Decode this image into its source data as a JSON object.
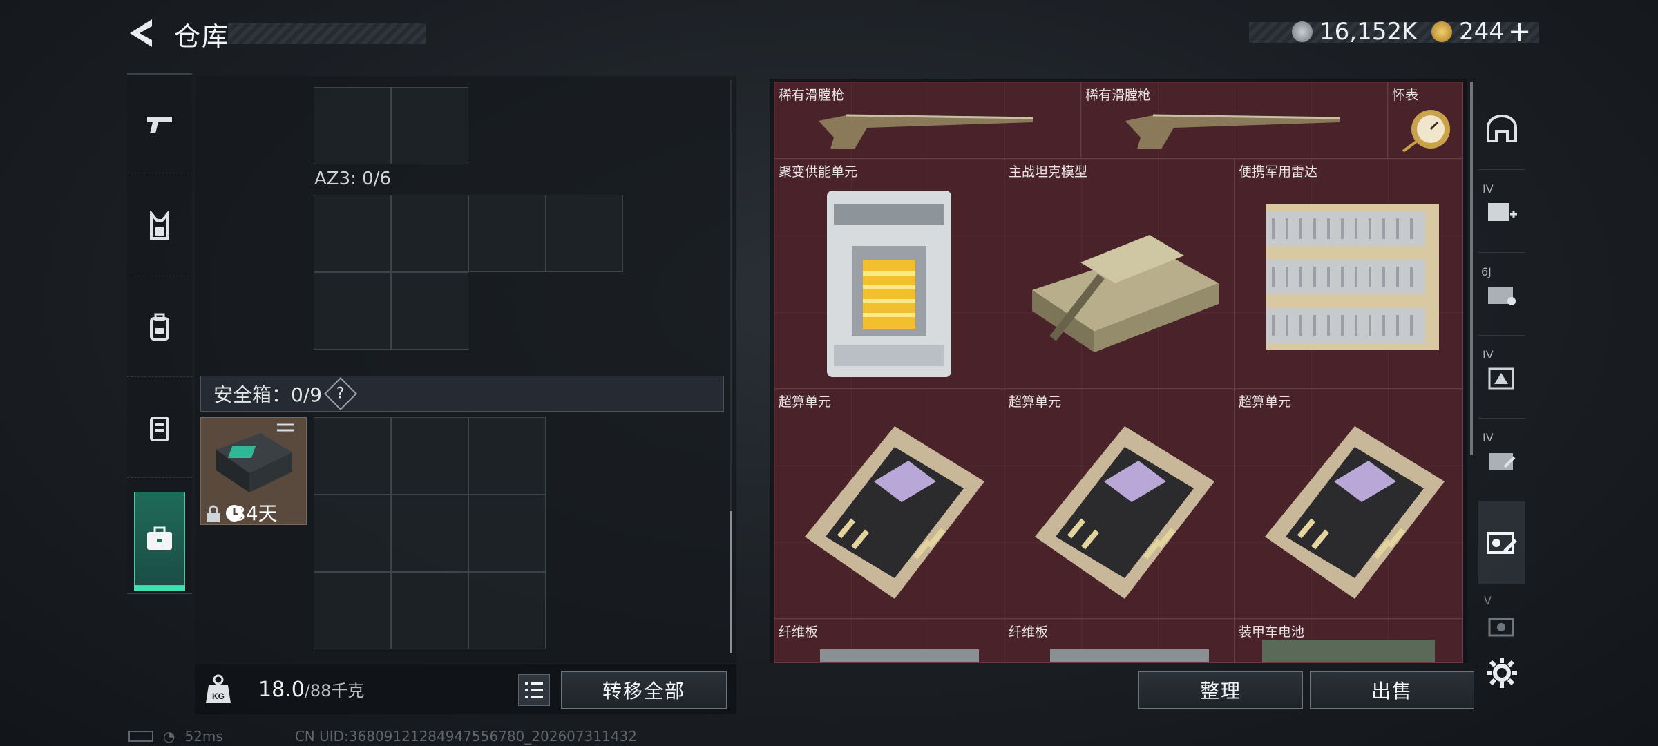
{
  "header": {
    "title": "仓库",
    "currency_silver": "16,152K",
    "currency_gold": "244",
    "gold_plus": "+"
  },
  "left_tabs": [
    {
      "name": "weapon",
      "icon": "pistol-icon"
    },
    {
      "name": "vest",
      "icon": "vest-icon"
    },
    {
      "name": "backpack",
      "icon": "backpack-icon"
    },
    {
      "name": "container",
      "icon": "rig-icon"
    },
    {
      "name": "safebox",
      "icon": "briefcase-icon",
      "active": true
    }
  ],
  "loadout": {
    "az3_label": "AZ3: 0/6",
    "safe_box_label": "安全箱：0/9",
    "help": "?",
    "safe_box_days": "34天"
  },
  "weight": {
    "current": "18.0",
    "max": "/88千克",
    "kg_icon_text": "KG"
  },
  "buttons": {
    "transfer_all": "转移全部",
    "organize": "整理",
    "sell": "出售"
  },
  "items": [
    {
      "label": "稀有滑膛枪"
    },
    {
      "label": "稀有滑膛枪"
    },
    {
      "label": "怀表"
    },
    {
      "label": "聚变供能单元"
    },
    {
      "label": "主战坦克模型"
    },
    {
      "label": "便携军用雷达"
    },
    {
      "label": "超算单元"
    },
    {
      "label": "超算单元"
    },
    {
      "label": "超算单元"
    },
    {
      "label": "纤维板"
    },
    {
      "label": "纤维板"
    },
    {
      "label": "装甲车电池"
    }
  ],
  "right_tabs": [
    {
      "text": ""
    },
    {
      "text": "IV"
    },
    {
      "text": "6J"
    },
    {
      "text": "IV"
    },
    {
      "text": "IV"
    },
    {
      "text": "",
      "active": true
    },
    {
      "text": "V"
    }
  ],
  "status": {
    "ping": "52ms",
    "uid": "CN UID:36809121284947556780_202607311432"
  },
  "colors": {
    "accent": "#3fe0b0",
    "item_bg": "#4a232a"
  }
}
